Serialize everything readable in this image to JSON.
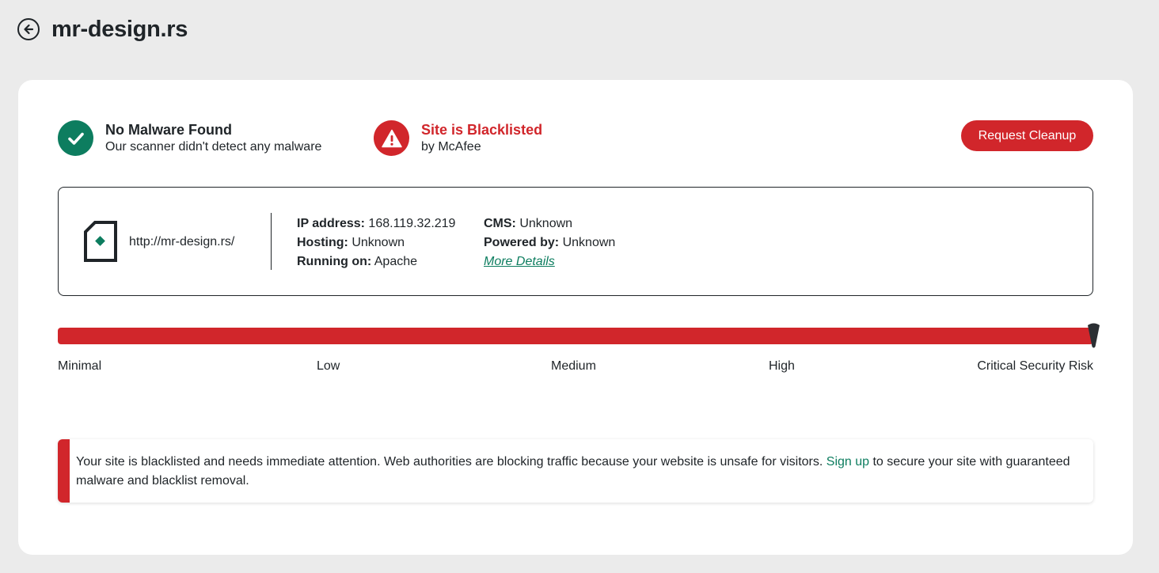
{
  "header": {
    "title": "mr-design.rs",
    "back_icon": "back-arrow-icon"
  },
  "status": {
    "malware": {
      "title": "No Malware Found",
      "subtitle": "Our scanner didn't detect any malware",
      "icon": "checkmark-icon",
      "color": "#0d7d5f"
    },
    "blacklist": {
      "title": "Site is Blacklisted",
      "subtitle": "by McAfee",
      "icon": "warning-icon",
      "color": "#d1262b"
    }
  },
  "actions": {
    "cleanup_label": "Request Cleanup"
  },
  "site_info": {
    "url": "http://mr-design.rs/",
    "ip_label": "IP address:",
    "ip_value": "168.119.32.219",
    "hosting_label": "Hosting:",
    "hosting_value": "Unknown",
    "running_label": "Running on:",
    "running_value": "Apache",
    "cms_label": "CMS:",
    "cms_value": "Unknown",
    "powered_label": "Powered by:",
    "powered_value": "Unknown",
    "more_details": "More Details"
  },
  "risk": {
    "level": 1.0,
    "labels": [
      "Minimal",
      "Low",
      "Medium",
      "High",
      "Critical Security Risk"
    ]
  },
  "alert": {
    "text_before": "Your site is blacklisted and needs immediate attention. Web authorities are blocking traffic because your website is unsafe for visitors. ",
    "link": "Sign up",
    "text_after": " to secure your site with guaranteed malware and blacklist removal."
  },
  "colors": {
    "accent_green": "#0d7d5f",
    "danger_red": "#d1262b",
    "background": "#ebebeb"
  }
}
